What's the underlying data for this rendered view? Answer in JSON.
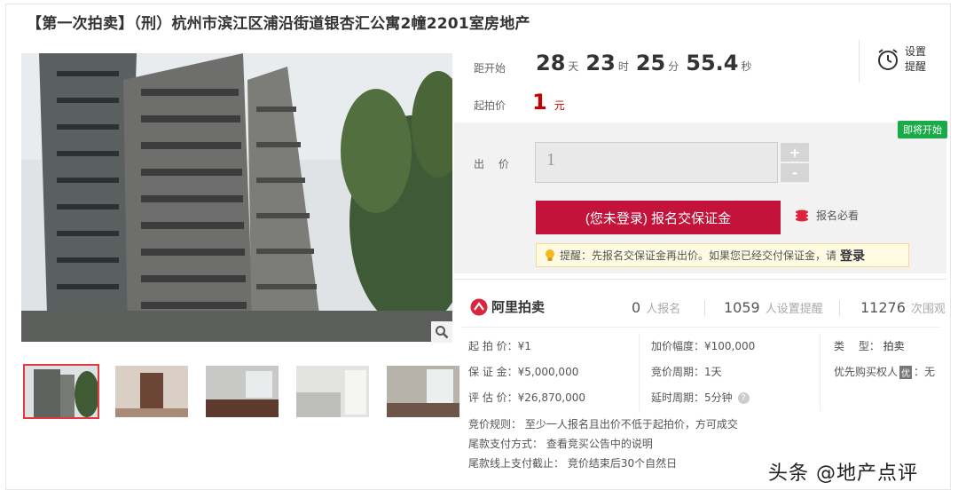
{
  "title": "【第一次拍卖】（刑）杭州市滨江区浦沿街道银杏汇公寓2幢2201室房地产",
  "countdown": {
    "label": "距开始",
    "days": "28",
    "days_unit": "天",
    "hours": "23",
    "hours_unit": "时",
    "minutes": "25",
    "minutes_unit": "分",
    "seconds": "55.4",
    "seconds_unit": "秒"
  },
  "start_price": {
    "label": "起拍价",
    "value": "1",
    "unit": "元"
  },
  "reminder": {
    "line1": "设置",
    "line2": "提醒",
    "icon": "alarm-clock-icon"
  },
  "bid": {
    "badge": "即将开始",
    "label": "出 价",
    "input_value": "1",
    "plus": "+",
    "minus": "-",
    "signup_button": "(您未登录) 报名交保证金",
    "must_read": "报名必看",
    "tip_text": "提醒：先报名交保证金再出价。如果您已经交付保证金，请",
    "tip_login": "登录"
  },
  "stats": {
    "logo": "阿里拍卖",
    "signups_n": "0",
    "signups_t": "人报名",
    "reminders_n": "1059",
    "reminders_t": "人设置提醒",
    "views_n": "11276",
    "views_t": "次围观"
  },
  "info": {
    "start_price": "起 拍 价：¥1",
    "deposit": "保 证 金：¥5,000,000",
    "appraisal": "评 估 价：¥26,870,000",
    "increment": "加价幅度：¥100,000",
    "cycle": "竞价周期：1天",
    "extension": "延时周期：5分钟",
    "type_label": "类　 型：",
    "type_value": "拍卖",
    "priority_label": "优先购买权人",
    "priority_badge": "优",
    "priority_value": "：无"
  },
  "rules": {
    "rule1": "竞价规则：  至少一人报名且出价不低于起拍价，方可成交",
    "rule2": "尾款支付方式：   查看竞买公告中的说明",
    "rule3": "尾款线上支付截止：   竞价结束后30个自然日"
  },
  "watermark": "头条 @地产点评",
  "colors": {
    "accent": "#c4133a",
    "price": "#c40000",
    "badge": "#1aaa47"
  }
}
